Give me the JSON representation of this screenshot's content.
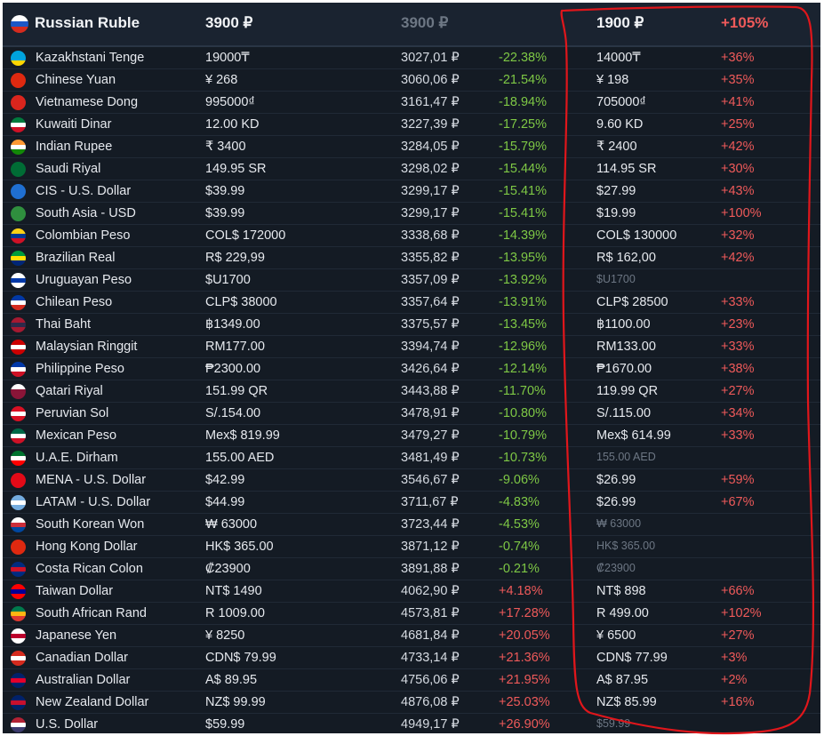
{
  "header": {
    "currency": "Russian Ruble",
    "price": "3900 ₽",
    "price_rub": "3900 ₽",
    "alt_price": "1900 ₽",
    "alt_pct": "+105%",
    "flag_colors": [
      "#ffffff",
      "#1c57c6",
      "#d52b1e"
    ]
  },
  "rows": [
    {
      "name": "Kazakhstani Tenge",
      "price": "19000₸",
      "rub": "3027,01 ₽",
      "diff": "-22.38%",
      "alt": "14000₸",
      "alt_pct": "+36%",
      "flag": [
        "#00a3dd",
        "#00a3dd",
        "#ffd700"
      ]
    },
    {
      "name": "Chinese Yuan",
      "price": "¥ 268",
      "rub": "3060,06 ₽",
      "diff": "-21.54%",
      "alt": "¥ 198",
      "alt_pct": "+35%",
      "flag": [
        "#de2910",
        "#de2910",
        "#de2910"
      ]
    },
    {
      "name": "Vietnamese Dong",
      "price": "995000₫",
      "rub": "3161,47 ₽",
      "diff": "-18.94%",
      "alt": "705000₫",
      "alt_pct": "+41%",
      "flag": [
        "#da251d",
        "#da251d",
        "#da251d"
      ]
    },
    {
      "name": "Kuwaiti Dinar",
      "price": "12.00 KD",
      "rub": "3227,39 ₽",
      "diff": "-17.25%",
      "alt": "9.60 KD",
      "alt_pct": "+25%",
      "flag": [
        "#007a3d",
        "#ffffff",
        "#ce1126"
      ]
    },
    {
      "name": "Indian Rupee",
      "price": "₹ 3400",
      "rub": "3284,05 ₽",
      "diff": "-15.79%",
      "alt": "₹ 2400",
      "alt_pct": "+42%",
      "flag": [
        "#ff9933",
        "#ffffff",
        "#138808"
      ]
    },
    {
      "name": "Saudi Riyal",
      "price": "149.95 SR",
      "rub": "3298,02 ₽",
      "diff": "-15.44%",
      "alt": "114.95 SR",
      "alt_pct": "+30%",
      "flag": [
        "#006c35",
        "#006c35",
        "#006c35"
      ]
    },
    {
      "name": "CIS - U.S. Dollar",
      "price": "$39.99",
      "rub": "3299,17 ₽",
      "diff": "-15.41%",
      "alt": "$27.99",
      "alt_pct": "+43%",
      "flag": [
        "#1f6fd1",
        "#1f6fd1",
        "#1f6fd1"
      ]
    },
    {
      "name": "South Asia - USD",
      "price": "$39.99",
      "rub": "3299,17 ₽",
      "diff": "-15.41%",
      "alt": "$19.99",
      "alt_pct": "+100%",
      "flag": [
        "#2f8f3e",
        "#2f8f3e",
        "#2f8f3e"
      ]
    },
    {
      "name": "Colombian Peso",
      "price": "COL$ 172000",
      "rub": "3338,68 ₽",
      "diff": "-14.39%",
      "alt": "COL$ 130000",
      "alt_pct": "+32%",
      "flag": [
        "#fcd116",
        "#003893",
        "#ce1126"
      ]
    },
    {
      "name": "Brazilian Real",
      "price": "R$ 229,99",
      "rub": "3355,82 ₽",
      "diff": "-13.95%",
      "alt": "R$ 162,00",
      "alt_pct": "+42%",
      "flag": [
        "#009c3b",
        "#ffdf00",
        "#002776"
      ]
    },
    {
      "name": "Uruguayan Peso",
      "price": "$U1700",
      "rub": "3357,09 ₽",
      "diff": "-13.92%",
      "alt": "$U1700",
      "alt_pct": "",
      "flag": [
        "#ffffff",
        "#0038a8",
        "#ffffff"
      ]
    },
    {
      "name": "Chilean Peso",
      "price": "CLP$ 38000",
      "rub": "3357,64 ₽",
      "diff": "-13.91%",
      "alt": "CLP$ 28500",
      "alt_pct": "+33%",
      "flag": [
        "#0039a6",
        "#ffffff",
        "#d52b1e"
      ]
    },
    {
      "name": "Thai Baht",
      "price": "฿1349.00",
      "rub": "3375,57 ₽",
      "diff": "-13.45%",
      "alt": "฿1100.00",
      "alt_pct": "+23%",
      "flag": [
        "#a51931",
        "#2d2a4a",
        "#a51931"
      ]
    },
    {
      "name": "Malaysian Ringgit",
      "price": "RM177.00",
      "rub": "3394,74 ₽",
      "diff": "-12.96%",
      "alt": "RM133.00",
      "alt_pct": "+33%",
      "flag": [
        "#cc0001",
        "#ffffff",
        "#cc0001"
      ]
    },
    {
      "name": "Philippine Peso",
      "price": "₱2300.00",
      "rub": "3426,64 ₽",
      "diff": "-12.14%",
      "alt": "₱1670.00",
      "alt_pct": "+38%",
      "flag": [
        "#0038a8",
        "#ffffff",
        "#ce1126"
      ]
    },
    {
      "name": "Qatari Riyal",
      "price": "151.99 QR",
      "rub": "3443,88 ₽",
      "diff": "-11.70%",
      "alt": "119.99 QR",
      "alt_pct": "+27%",
      "flag": [
        "#ffffff",
        "#8a1538",
        "#8a1538"
      ]
    },
    {
      "name": "Peruvian Sol",
      "price": "S/.154.00",
      "rub": "3478,91 ₽",
      "diff": "-10.80%",
      "alt": "S/.115.00",
      "alt_pct": "+34%",
      "flag": [
        "#d91023",
        "#ffffff",
        "#d91023"
      ]
    },
    {
      "name": "Mexican Peso",
      "price": "Mex$ 819.99",
      "rub": "3479,27 ₽",
      "diff": "-10.79%",
      "alt": "Mex$ 614.99",
      "alt_pct": "+33%",
      "flag": [
        "#006847",
        "#ffffff",
        "#ce1126"
      ]
    },
    {
      "name": "U.A.E. Dirham",
      "price": "155.00 AED",
      "rub": "3481,49 ₽",
      "diff": "-10.73%",
      "alt": "155.00 AED",
      "alt_pct": "",
      "flag": [
        "#00732f",
        "#ffffff",
        "#ff0000"
      ]
    },
    {
      "name": "MENA - U.S. Dollar",
      "price": "$42.99",
      "rub": "3546,67 ₽",
      "diff": "-9.06%",
      "alt": "$26.99",
      "alt_pct": "+59%",
      "flag": [
        "#e30a17",
        "#e30a17",
        "#e30a17"
      ]
    },
    {
      "name": "LATAM - U.S. Dollar",
      "price": "$44.99",
      "rub": "3711,67 ₽",
      "diff": "-4.83%",
      "alt": "$26.99",
      "alt_pct": "+67%",
      "flag": [
        "#74acdf",
        "#ffffff",
        "#74acdf"
      ]
    },
    {
      "name": "South Korean Won",
      "price": "₩ 63000",
      "rub": "3723,44 ₽",
      "diff": "-4.53%",
      "alt": "₩ 63000",
      "alt_pct": "",
      "flag": [
        "#ffffff",
        "#cd2e3a",
        "#0047a0"
      ]
    },
    {
      "name": "Hong Kong Dollar",
      "price": "HK$ 365.00",
      "rub": "3871,12 ₽",
      "diff": "-0.74%",
      "alt": "HK$ 365.00",
      "alt_pct": "",
      "flag": [
        "#de2910",
        "#de2910",
        "#de2910"
      ]
    },
    {
      "name": "Costa Rican Colon",
      "price": "₡23900",
      "rub": "3891,88 ₽",
      "diff": "-0.21%",
      "alt": "₡23900",
      "alt_pct": "",
      "flag": [
        "#002b7f",
        "#ce1126",
        "#002b7f"
      ]
    },
    {
      "name": "Taiwan Dollar",
      "price": "NT$ 1490",
      "rub": "4062,90 ₽",
      "diff": "+4.18%",
      "alt": "NT$ 898",
      "alt_pct": "+66%",
      "flag": [
        "#fe0000",
        "#000095",
        "#fe0000"
      ]
    },
    {
      "name": "South African Rand",
      "price": "R 1009.00",
      "rub": "4573,81 ₽",
      "diff": "+17.28%",
      "alt": "R 499.00",
      "alt_pct": "+102%",
      "flag": [
        "#007a4d",
        "#ffb612",
        "#de3831"
      ]
    },
    {
      "name": "Japanese Yen",
      "price": "¥ 8250",
      "rub": "4681,84 ₽",
      "diff": "+20.05%",
      "alt": "¥ 6500",
      "alt_pct": "+27%",
      "flag": [
        "#ffffff",
        "#bc002d",
        "#ffffff"
      ]
    },
    {
      "name": "Canadian Dollar",
      "price": "CDN$ 79.99",
      "rub": "4733,14 ₽",
      "diff": "+21.36%",
      "alt": "CDN$ 77.99",
      "alt_pct": "+3%",
      "flag": [
        "#d52b1e",
        "#ffffff",
        "#d52b1e"
      ]
    },
    {
      "name": "Australian Dollar",
      "price": "A$ 89.95",
      "rub": "4756,06 ₽",
      "diff": "+21.95%",
      "alt": "A$ 87.95",
      "alt_pct": "+2%",
      "flag": [
        "#012169",
        "#e4002b",
        "#012169"
      ]
    },
    {
      "name": "New Zealand Dollar",
      "price": "NZ$ 99.99",
      "rub": "4876,08 ₽",
      "diff": "+25.03%",
      "alt": "NZ$ 85.99",
      "alt_pct": "+16%",
      "flag": [
        "#012169",
        "#c8102e",
        "#012169"
      ]
    },
    {
      "name": "U.S. Dollar",
      "price": "$59.99",
      "rub": "4949,17 ₽",
      "diff": "+26.90%",
      "alt": "$59.99",
      "alt_pct": "",
      "flag": [
        "#b22234",
        "#ffffff",
        "#3c3b6e"
      ]
    }
  ],
  "annotation": {
    "color": "#e0161b"
  },
  "colors": {
    "background": "#141b24",
    "negative": "#7ec845",
    "positive": "#ef5a5a"
  }
}
